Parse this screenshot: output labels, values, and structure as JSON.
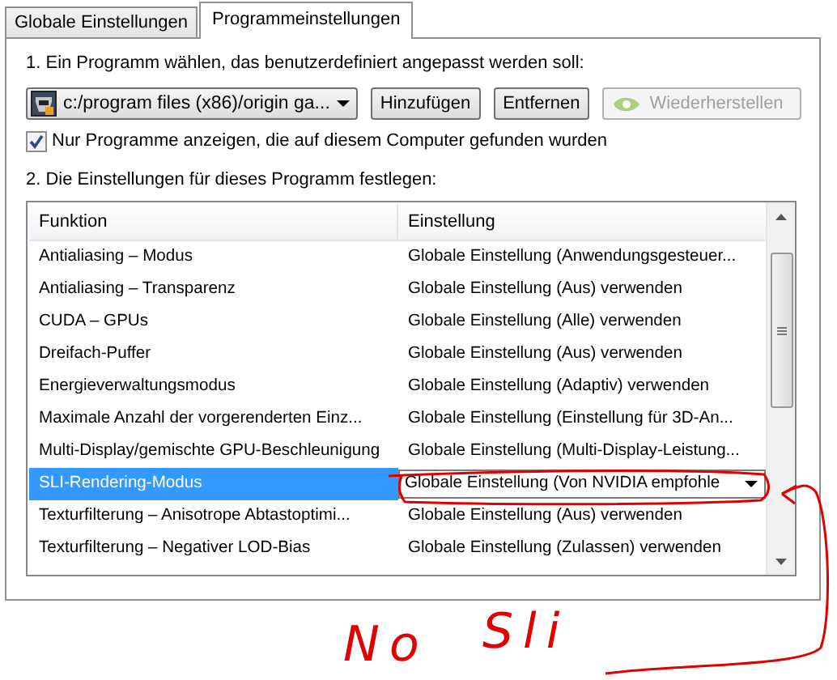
{
  "tabs": [
    {
      "label": "Globale Einstellungen",
      "selected": false
    },
    {
      "label": "Programmeinstellungen",
      "selected": true
    }
  ],
  "step1": {
    "label": "1. Ein Programm wählen, das benutzerdefiniert angepasst werden soll:",
    "program": "c:/program files (x86)/origin ga...",
    "buttons": [
      {
        "label": "Hinzufügen",
        "disabled": false,
        "kind": "plain"
      },
      {
        "label": "Entfernen",
        "disabled": false,
        "kind": "plain"
      },
      {
        "label": "Wiederherstellen",
        "disabled": true,
        "kind": "icon"
      }
    ],
    "filter": {
      "label": "Nur Programme anzeigen, die auf diesem Computer gefunden wurden",
      "checked": true
    }
  },
  "step2": {
    "label": "2. Die Einstellungen für dieses Programm festlegen:",
    "columns": [
      "Funktion",
      "Einstellung"
    ],
    "rows": [
      {
        "feature": "Antialiasing – Modus",
        "setting": "Globale Einstellung (Anwendungsgesteuer...",
        "selected": false
      },
      {
        "feature": "Antialiasing – Transparenz",
        "setting": "Globale Einstellung (Aus) verwenden",
        "selected": false
      },
      {
        "feature": "CUDA – GPUs",
        "setting": "Globale Einstellung (Alle) verwenden",
        "selected": false
      },
      {
        "feature": "Dreifach-Puffer",
        "setting": "Globale Einstellung (Aus) verwenden",
        "selected": false
      },
      {
        "feature": "Energieverwaltungsmodus",
        "setting": "Globale Einstellung (Adaptiv) verwenden",
        "selected": false
      },
      {
        "feature": "Maximale Anzahl der vorgerenderten Einz...",
        "setting": "Globale Einstellung (Einstellung für 3D-An...",
        "selected": false
      },
      {
        "feature": "Multi-Display/gemischte GPU-Beschleunigung",
        "setting": "Globale Einstellung (Multi-Display-Leistung...",
        "selected": false
      },
      {
        "feature": "SLI-Rendering-Modus",
        "setting": "Globale Einstellung (Von NVIDIA empfohle",
        "selected": true
      },
      {
        "feature": "Texturfilterung – Anisotrope Abtastoptimi...",
        "setting": "Globale Einstellung (Aus) verwenden",
        "selected": false
      },
      {
        "feature": "Texturfilterung – Negativer LOD-Bias",
        "setting": "Globale Einstellung (Zulassen) verwenden",
        "selected": false
      }
    ]
  },
  "annotation": {
    "words": [
      "No",
      "Sli"
    ]
  }
}
